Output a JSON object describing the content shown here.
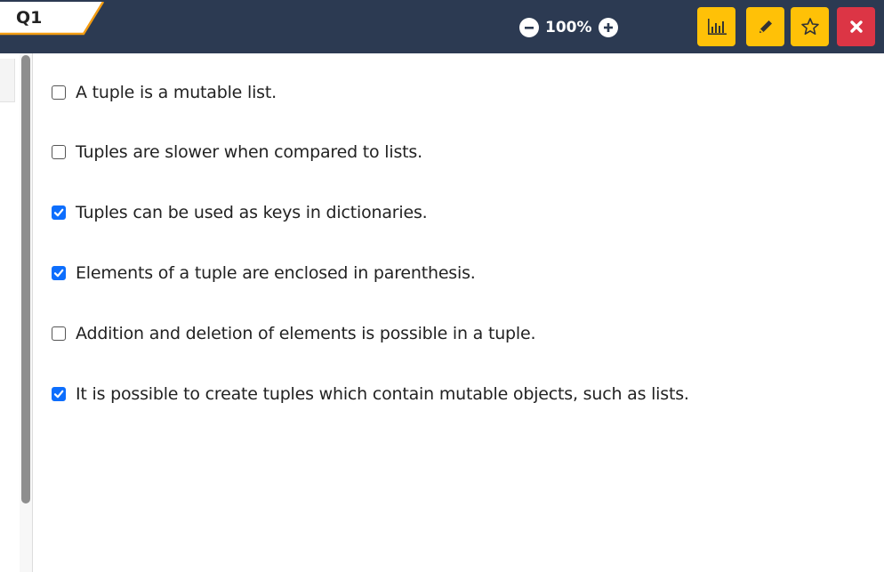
{
  "header": {
    "tab_label": "Q1",
    "zoom_level": "100%",
    "colors": {
      "bar": "#2c3a52",
      "accent": "#f39c12",
      "yellow_button": "#ffc107",
      "red_button": "#dc3545"
    },
    "buttons": [
      {
        "icon": "bar-chart-icon"
      },
      {
        "icon": "pencil-icon"
      },
      {
        "icon": "star-icon"
      },
      {
        "icon": "close-icon"
      }
    ]
  },
  "options": [
    {
      "text": "A tuple is a mutable list.",
      "checked": false
    },
    {
      "text": "Tuples are slower when compared to lists.",
      "checked": false
    },
    {
      "text": "Tuples can be used as keys in dictionaries.",
      "checked": true
    },
    {
      "text": "Elements of a tuple are enclosed in parenthesis.",
      "checked": true
    },
    {
      "text": "Addition and deletion of elements is possible in a tuple.",
      "checked": false
    },
    {
      "text": "It is possible to create tuples which contain mutable objects, such as lists.",
      "checked": true
    }
  ]
}
